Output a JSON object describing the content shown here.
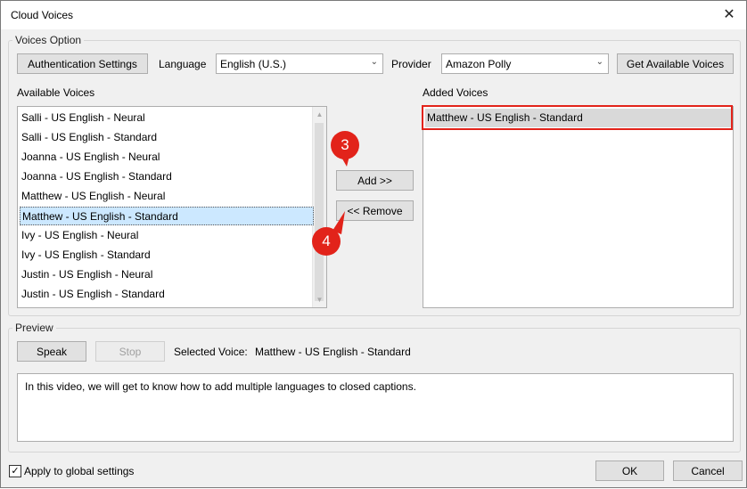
{
  "window": {
    "title": "Cloud Voices"
  },
  "voices_option": {
    "group_label": "Voices Option",
    "auth_button": "Authentication Settings",
    "language_label": "Language",
    "language_value": "English (U.S.)",
    "provider_label": "Provider",
    "provider_value": "Amazon Polly",
    "get_voices_button": "Get Available Voices",
    "available_label": "Available Voices",
    "available_voices": [
      "Salli - US English - Neural",
      "Salli - US English - Standard",
      "Joanna - US English - Neural",
      "Joanna - US English - Standard",
      "Matthew - US English - Neural",
      "Matthew - US English - Standard",
      "Ivy - US English - Neural",
      "Ivy - US English - Standard",
      "Justin - US English - Neural",
      "Justin - US English - Standard"
    ],
    "selected_index": 5,
    "add_button": "Add >>",
    "remove_button": "<< Remove",
    "added_label": "Added Voices",
    "added_voices": [
      "Matthew - US English - Standard"
    ]
  },
  "annotations": {
    "step3": "3",
    "step4": "4",
    "accent_color": "#e2231a"
  },
  "preview": {
    "group_label": "Preview",
    "speak_button": "Speak",
    "stop_button": "Stop",
    "selected_voice_label": "Selected Voice:",
    "selected_voice_value": "Matthew - US English - Standard",
    "text": "In this video, we will get to know how to add multiple languages to closed captions."
  },
  "footer": {
    "apply_global_label": "Apply to global settings",
    "apply_global_checked": true,
    "ok_button": "OK",
    "cancel_button": "Cancel"
  }
}
